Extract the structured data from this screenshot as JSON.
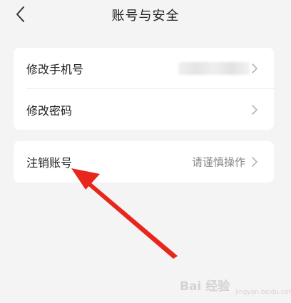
{
  "header": {
    "title": "账号与安全",
    "back_icon": "chevron-left-icon"
  },
  "account_section": {
    "items": [
      {
        "label": "修改手机号",
        "value": ""
      },
      {
        "label": "修改密码",
        "value": ""
      }
    ]
  },
  "danger_section": {
    "items": [
      {
        "label": "注销账号",
        "value": "请谨慎操作"
      }
    ]
  },
  "annotation": {
    "arrow_color": "#e8261c"
  },
  "watermark": {
    "text": "Bai 经验",
    "sub": "jingyan.baidu.com"
  },
  "colors": {
    "background": "#f4f4f4",
    "card": "#ffffff",
    "text_primary": "#222222",
    "text_secondary": "#888888",
    "chevron": "#b5b5b5"
  }
}
